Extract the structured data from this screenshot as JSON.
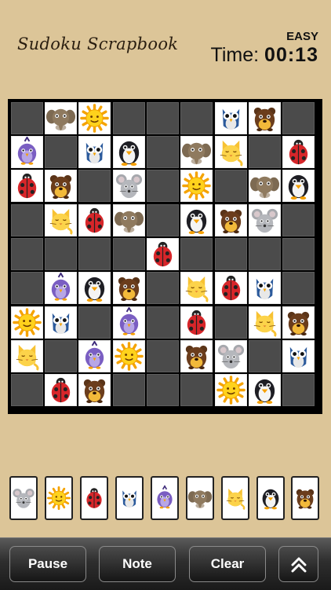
{
  "header": {
    "title": "Sudoku Scrapbook",
    "difficulty": "EASY",
    "time_label": "Time:",
    "time_value": "00:13"
  },
  "board": {
    "rows": [
      [
        "",
        "elephant",
        "sun",
        "",
        "",
        "",
        "owl",
        "bear",
        ""
      ],
      [
        "bird",
        "",
        "owl",
        "penguin",
        "",
        "elephant",
        "cat",
        "",
        "ladybug"
      ],
      [
        "ladybug",
        "bear",
        "",
        "mouse",
        "",
        "sun",
        "",
        "elephant",
        "penguin"
      ],
      [
        "",
        "cat",
        "ladybug",
        "elephant",
        "",
        "penguin",
        "bear",
        "mouse",
        ""
      ],
      [
        "",
        "",
        "",
        "",
        "ladybug",
        "",
        "",
        "",
        ""
      ],
      [
        "",
        "bird",
        "penguin",
        "bear",
        "",
        "cat",
        "ladybug",
        "owl",
        ""
      ],
      [
        "sun",
        "owl",
        "",
        "bird",
        "",
        "ladybug",
        "",
        "cat",
        "bear"
      ],
      [
        "cat",
        "",
        "bird",
        "sun",
        "",
        "bear",
        "mouse",
        "",
        "owl"
      ],
      [
        "",
        "ladybug",
        "bear",
        "",
        "",
        "",
        "sun",
        "penguin",
        ""
      ]
    ]
  },
  "tray": [
    "mouse",
    "sun",
    "ladybug",
    "owl",
    "bird",
    "elephant",
    "cat",
    "penguin",
    "bear"
  ],
  "toolbar": {
    "pause_label": "Pause",
    "note_label": "Note",
    "clear_label": "Clear",
    "collapse_icon": "double-chevron-up-icon"
  }
}
